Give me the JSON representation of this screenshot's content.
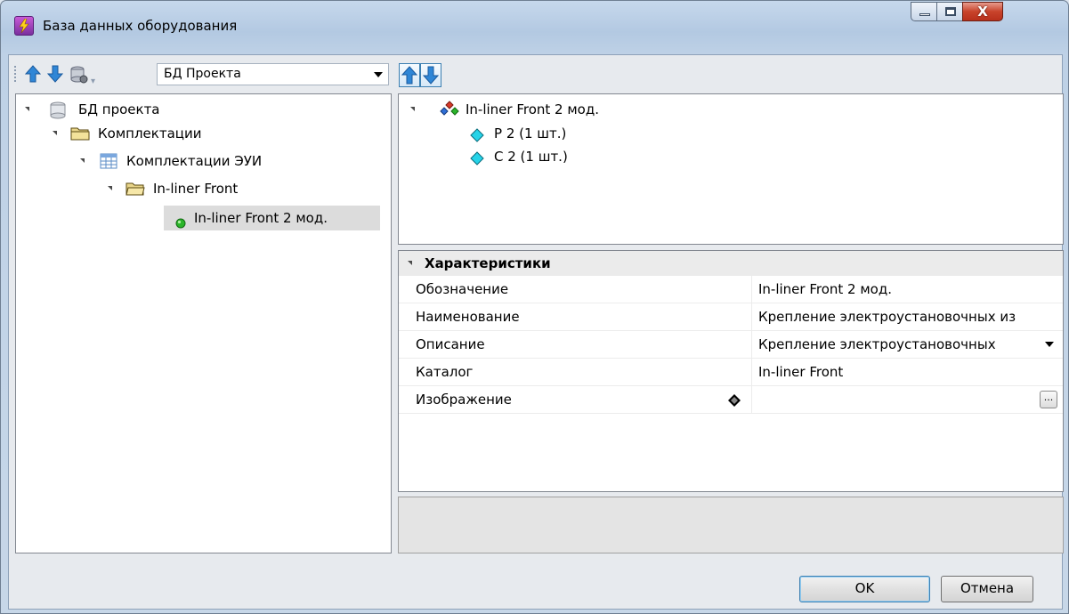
{
  "window": {
    "title": "База данных оборудования",
    "close_glyph": "X"
  },
  "left": {
    "db_select": {
      "value": "БД Проекта"
    },
    "tree": [
      {
        "label": "БД проекта",
        "icon": "database-icon"
      },
      {
        "label": "Комплектации",
        "icon": "folder-icon"
      },
      {
        "label": "Комплектации ЭУИ",
        "icon": "table-icon"
      },
      {
        "label": "In-liner Front",
        "icon": "folder-open-icon"
      },
      {
        "label": "In-liner Front 2 мод.",
        "icon": "green-dot-icon"
      }
    ]
  },
  "right": {
    "structure": {
      "root": "In-liner Front 2 мод.",
      "children": [
        "Р  2  (1 шт.)",
        "С 2  (1 шт.)"
      ]
    },
    "properties": {
      "category": "Характеристики",
      "rows": [
        {
          "name": "Обозначение",
          "value": "In-liner Front 2 мод."
        },
        {
          "name": "Наименование",
          "value": "Крепление электроустановочных из"
        },
        {
          "name": "Описание",
          "value": "Крепление электроустановочных"
        },
        {
          "name": "Каталог",
          "value": "In-liner Front"
        },
        {
          "name": "Изображение",
          "value": ""
        }
      ],
      "browse_label": "..."
    }
  },
  "buttons": {
    "ok": "OK",
    "cancel": "Отмена"
  },
  "colors": {
    "selection": "#dcdcdc",
    "diamond": "#26d3e8",
    "accent_blue": "#3c7fb1"
  }
}
